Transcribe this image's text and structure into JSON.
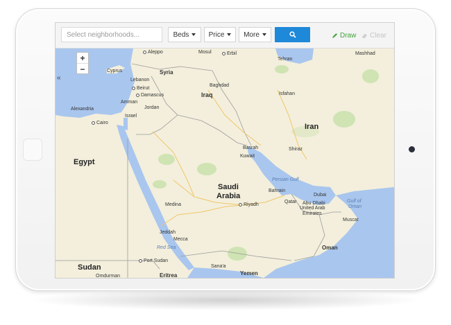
{
  "toolbar": {
    "search_placeholder": "Select neighborhoods...",
    "beds_label": "Beds",
    "price_label": "Price",
    "more_label": "More",
    "draw_label": "Draw",
    "clear_label": "Clear",
    "collapse_label": "«"
  },
  "zoom": {
    "in": "+",
    "out": "−"
  },
  "map": {
    "countries": {
      "iran": "Iran",
      "iraq": "Iraq",
      "syria": "Syria",
      "lebanon": "Lebanon",
      "israel": "Israel",
      "jordan": "Jordan",
      "egypt": "Egypt",
      "saudi1": "Saudi",
      "saudi2": "Arabia",
      "kuwait": "Kuwait",
      "bahrain": "Bahrain",
      "qatar": "Qatar",
      "uae1": "United Arab",
      "uae2": "Emirates",
      "oman": "Oman",
      "yemen": "Yemen",
      "sudan": "Sudan",
      "eritrea": "Eritrea",
      "cyprus": "Cyprus"
    },
    "cities": {
      "aleppo": "Aleppo",
      "mosul": "Mosul",
      "erbil": "Erbil",
      "tehran": "Tehran",
      "mashhad": "Mashhad",
      "baghdad": "Baghdad",
      "damascus": "Damascus",
      "beirut": "Beirut",
      "amman": "Amman",
      "isfahan": "Isfahan",
      "alexandria": "Alexandria",
      "cairo": "Cairo",
      "basrah": "Basrah",
      "shiraz": "Shiraz",
      "dubai": "Dubai",
      "abu_dhabi": "Abu Dhabi",
      "muscat": "Muscat",
      "medina": "Medina",
      "riyadh": "Riyadh",
      "jeddah": "Jeddah",
      "mecca": "Mecca",
      "port_sudan": "Port Sudan",
      "sanaa": "Sana'a",
      "omdurman": "Omdurman"
    },
    "waters": {
      "persian_gulf": "Persian Gulf",
      "gulf_of_oman1": "Gulf of",
      "gulf_of_oman2": "Oman",
      "red_sea": "Red Sea"
    }
  },
  "colors": {
    "land": "#f3efdc",
    "water": "#a9c6ee",
    "green": "#cfe3b3",
    "accent": "#1e88d9",
    "draw": "#3fa33a"
  }
}
